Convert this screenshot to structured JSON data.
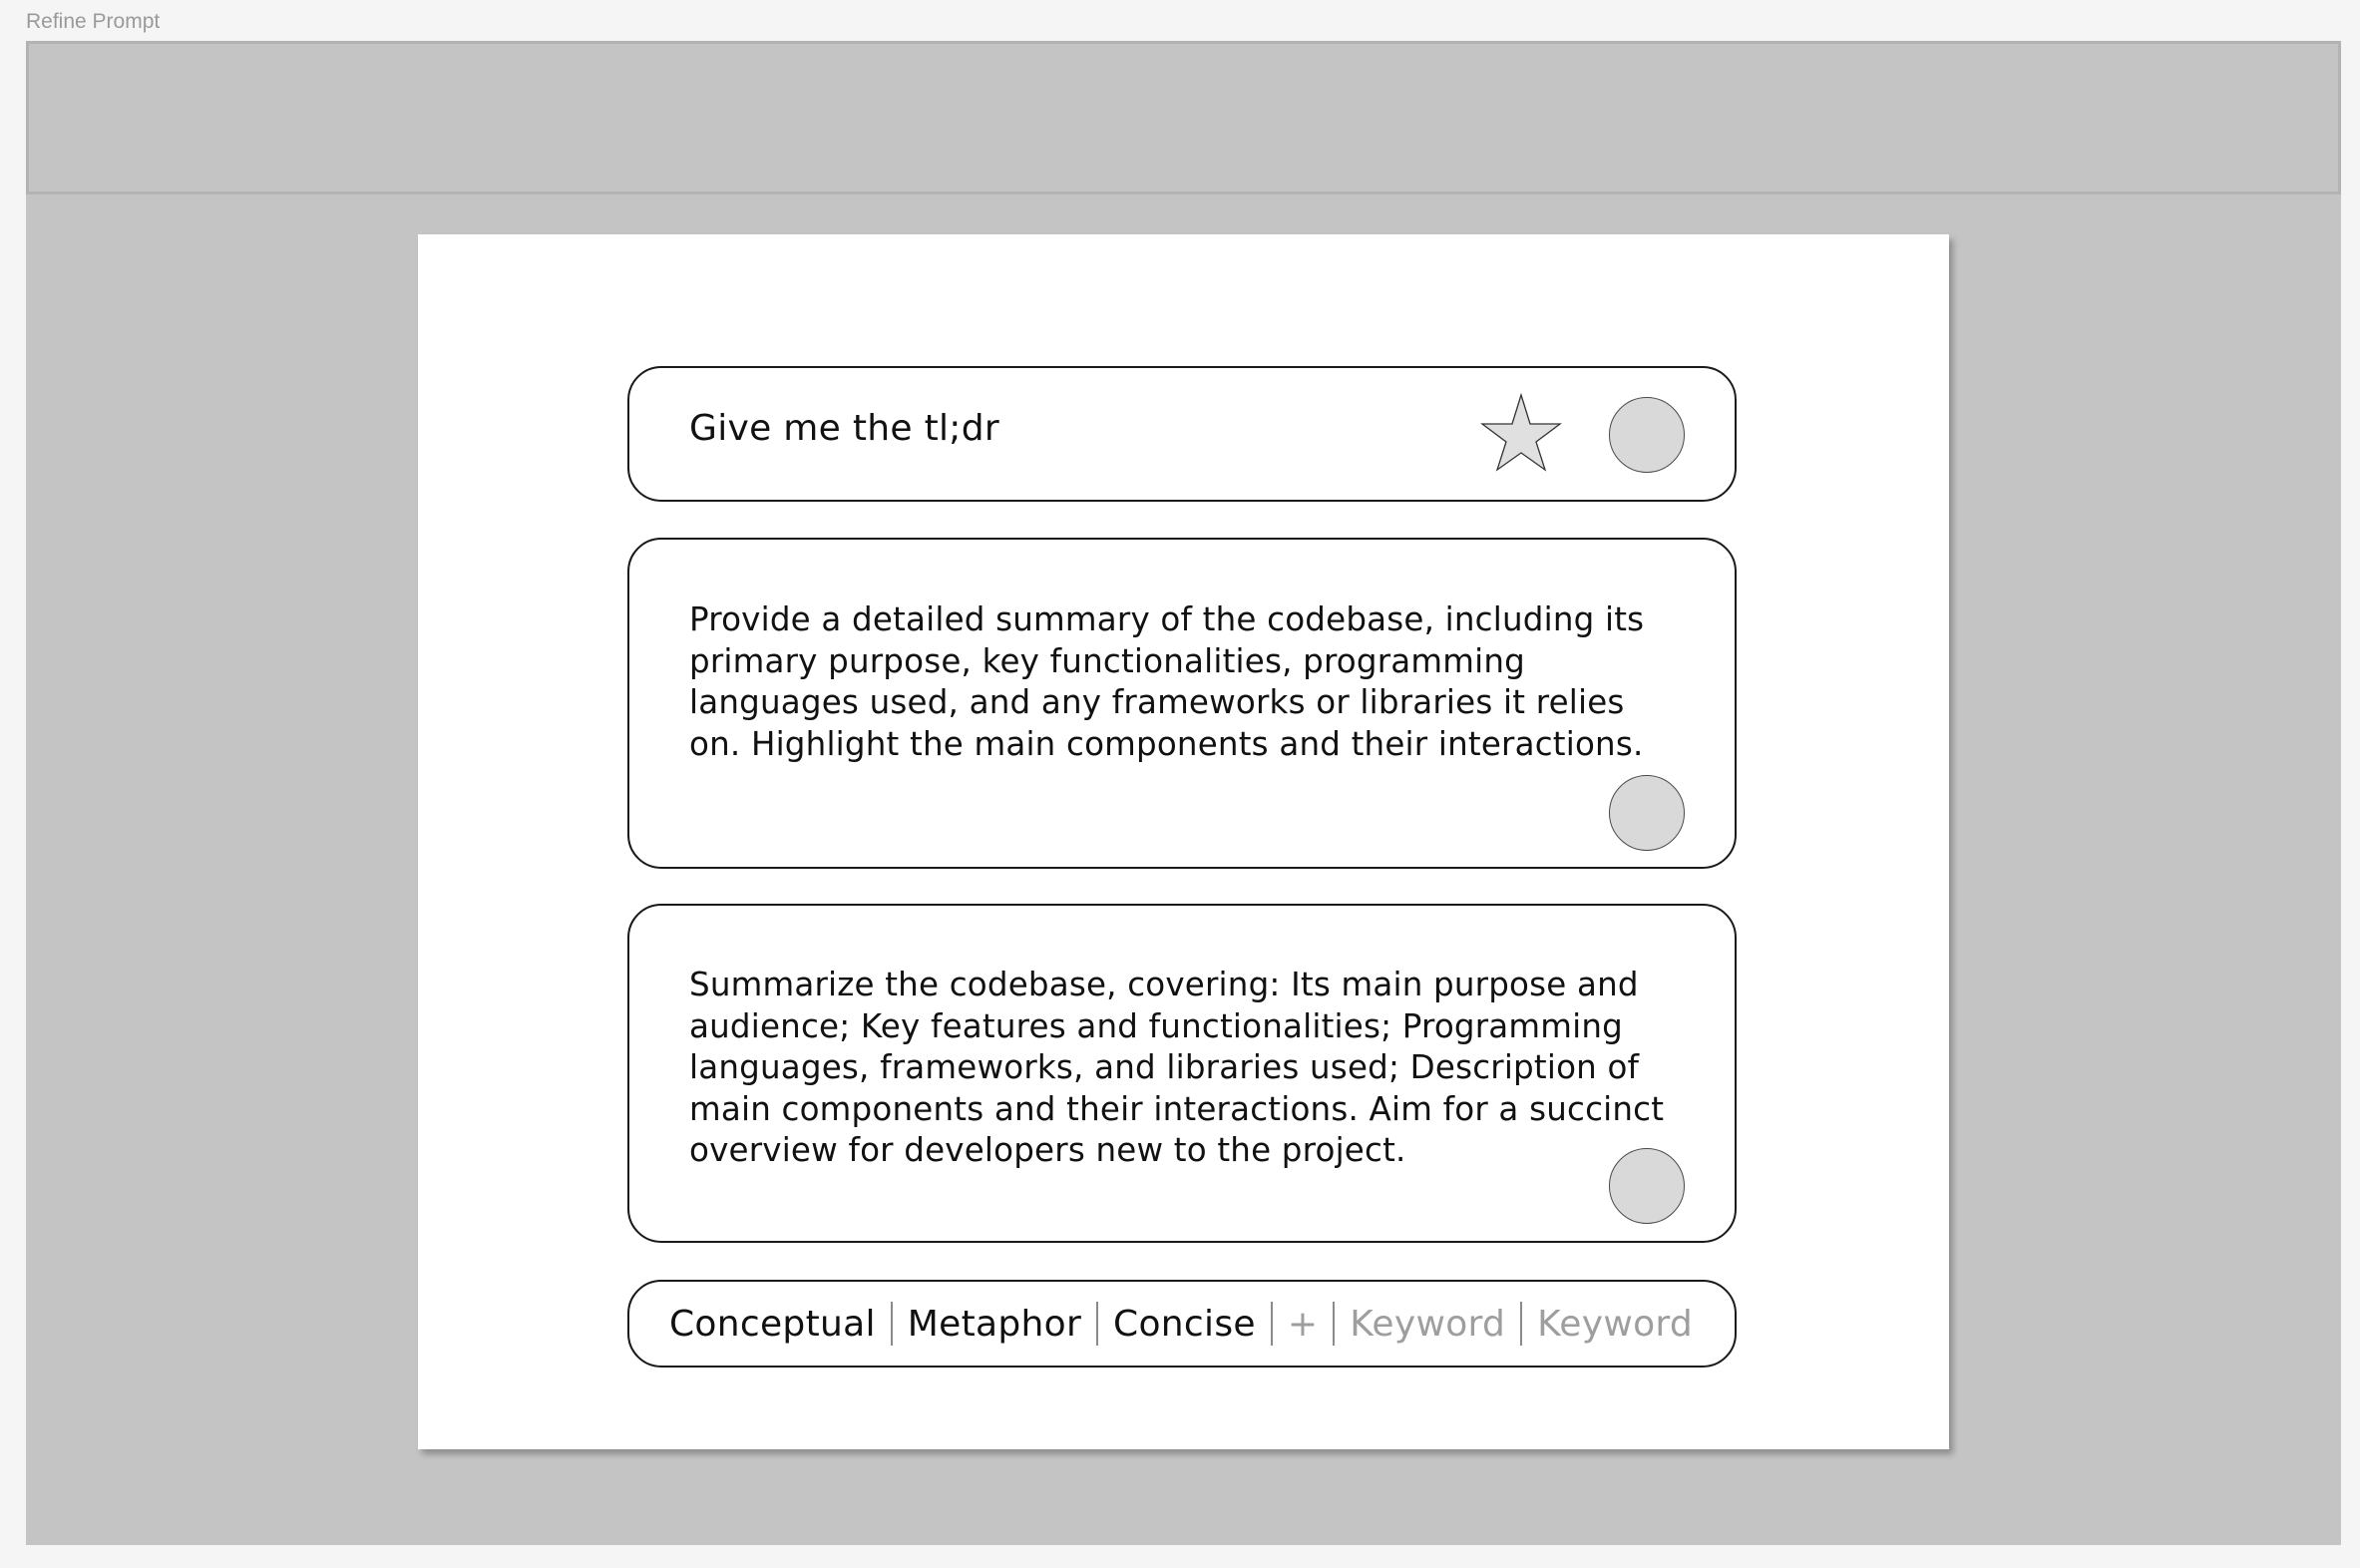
{
  "frame": {
    "label": "Refine Prompt"
  },
  "prompts": {
    "tldr": "Give me the tl;dr",
    "detailed": "Provide a detailed summary of the codebase, including its primary purpose, key functionalities, programming languages used, and any frameworks or libraries it relies on. Highlight the main components and their interactions.",
    "concise": "Summarize the codebase, covering: Its main purpose and audience; Key features and functionalities; Programming languages, frameworks, and libraries used; Description of main components and their interactions. Aim for a succinct overview for developers new to the project."
  },
  "keywords": {
    "active": [
      "Conceptual",
      "Metaphor",
      "Concise"
    ],
    "add_label": "+",
    "placeholders": [
      "Keyword",
      "Keyword"
    ]
  },
  "icons": {
    "star": "star-icon",
    "circle": "circle-button"
  },
  "colors": {
    "frame_bg": "#c4c4c4",
    "card_bg": "#ffffff",
    "circle_fill": "#d9d9d9",
    "star_fill": "#e0e0e0",
    "muted_text": "#9e9e9e"
  }
}
